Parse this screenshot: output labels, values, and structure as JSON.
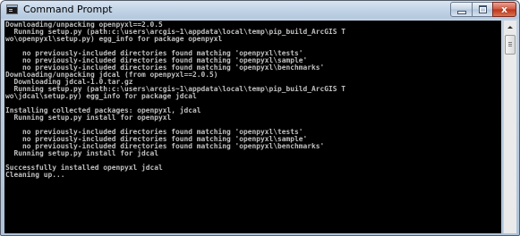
{
  "window": {
    "title": "Command Prompt",
    "icon": "cmd-icon",
    "controls": {
      "minimize_icon": "minimize-icon",
      "maximize_icon": "maximize-icon",
      "close_icon": "close-icon",
      "close_glyph": "x"
    }
  },
  "console": {
    "text_color": "#c0c0c0",
    "background": "#000000",
    "lines": [
      "Downloading/unpacking openpyxl==2.0.5",
      "  Running setup.py (path:c:\\users\\arcgis~1\\appdata\\local\\temp\\pip_build_ArcGIS T",
      "wo\\openpyxl\\setup.py) egg_info for package openpyxl",
      "",
      "    no previously-included directories found matching 'openpyxl\\tests'",
      "    no previously-included directories found matching 'openpyxl\\sample'",
      "    no previously-included directories found matching 'openpyxl\\benchmarks'",
      "Downloading/unpacking jdcal (from openpyxl==2.0.5)",
      "  Downloading jdcal-1.0.tar.gz",
      "  Running setup.py (path:c:\\users\\arcgis~1\\appdata\\local\\temp\\pip_build_ArcGIS T",
      "wo\\jdcal\\setup.py) egg_info for package jdcal",
      "",
      "Installing collected packages: openpyxl, jdcal",
      "  Running setup.py install for openpyxl",
      "",
      "    no previously-included directories found matching 'openpyxl\\tests'",
      "    no previously-included directories found matching 'openpyxl\\sample'",
      "    no previously-included directories found matching 'openpyxl\\benchmarks'",
      "  Running setup.py install for jdcal",
      "",
      "Successfully installed openpyxl jdcal",
      "Cleaning up..."
    ]
  },
  "scrollbar": {
    "up_icon": "scroll-up-arrow-icon",
    "thumb": "scroll-thumb"
  }
}
